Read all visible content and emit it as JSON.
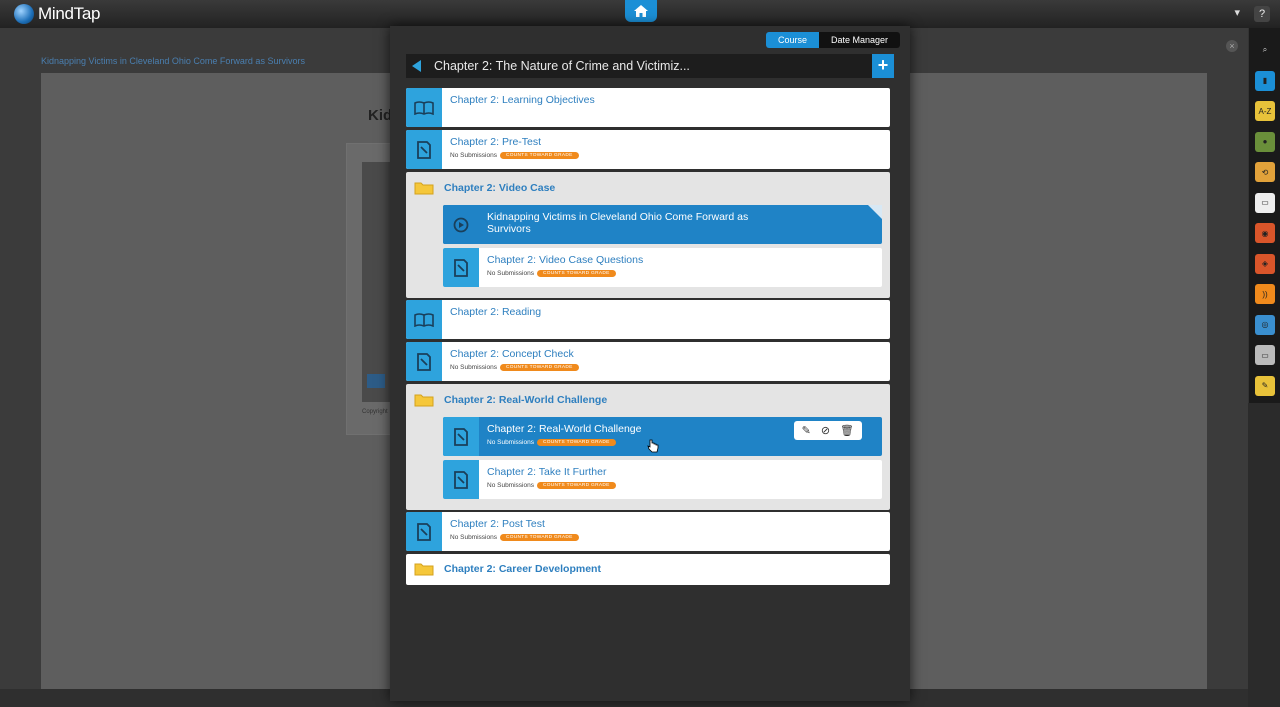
{
  "app": {
    "name": "MindTap"
  },
  "reader": {
    "title": "Kidnapping Victims in Cleveland Ohio Come Forward as Survivors",
    "page_heading": "Kidn",
    "copyright": "Copyright"
  },
  "panel": {
    "tabs": {
      "course": "Course",
      "date_manager": "Date Manager",
      "active": "Course"
    },
    "chapter_title": "Chapter 2: The Nature of Crime and Victimiz...",
    "items": [
      {
        "type": "reading",
        "title": "Chapter 2: Learning Objectives"
      },
      {
        "type": "activity",
        "title": "Chapter 2: Pre-Test",
        "submissions": "No Submissions",
        "badge": "COUNTS TOWARD GRADE"
      },
      {
        "type": "folder",
        "title": "Chapter 2: Video Case",
        "children": [
          {
            "type": "video",
            "title": "Kidnapping Victims in Cleveland Ohio Come Forward as Survivors",
            "selected": true
          },
          {
            "type": "activity",
            "title": "Chapter 2: Video Case Questions",
            "submissions": "No Submissions",
            "badge": "COUNTS TOWARD GRADE"
          }
        ]
      },
      {
        "type": "reading",
        "title": "Chapter 2: Reading"
      },
      {
        "type": "activity",
        "title": "Chapter 2: Concept Check",
        "submissions": "No Submissions",
        "badge": "COUNTS TOWARD GRADE"
      },
      {
        "type": "folder",
        "title": "Chapter 2: Real-World Challenge",
        "children": [
          {
            "type": "activity",
            "title": "Chapter 2: Real-World Challenge",
            "submissions": "No Submissions",
            "badge": "COUNTS TOWARD GRADE",
            "highlighted": true
          },
          {
            "type": "activity",
            "title": "Chapter 2: Take It Further",
            "submissions": "No Submissions",
            "badge": "COUNTS TOWARD GRADE"
          }
        ]
      },
      {
        "type": "activity",
        "title": "Chapter 2: Post Test",
        "submissions": "No Submissions",
        "badge": "COUNTS TOWARD GRADE"
      },
      {
        "type": "folder",
        "title": "Chapter 2: Career Development"
      }
    ]
  },
  "dock": {
    "icons": [
      "search-icon",
      "book-icon",
      "glossary-az-icon",
      "profile-icon",
      "flashcards-icon",
      "notes-icon",
      "merriam-webster-icon",
      "aplia-icon",
      "rss-feed-icon",
      "cengage-icon",
      "briefcase-icon",
      "highlighter-icon"
    ]
  },
  "colors": {
    "accent": "#1b8fd6",
    "badge": "#f08a1c",
    "link": "#2e7fbf"
  }
}
